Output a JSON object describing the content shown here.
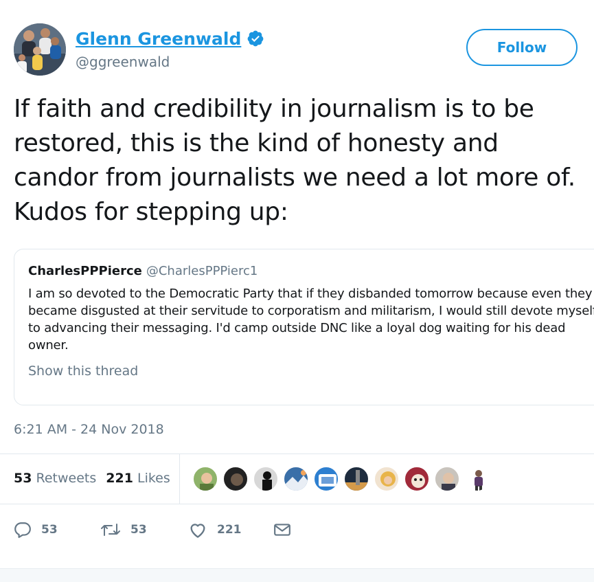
{
  "author": {
    "display_name": "Glenn Greenwald",
    "handle": "@ggreenwald",
    "verified": true
  },
  "follow_button": {
    "label": "Follow"
  },
  "tweet": {
    "text": "If faith and credibility in journalism is to be restored, this is the kind of honesty and candor from journalists we need a lot more of. Kudos for stepping up:"
  },
  "quoted_tweet": {
    "name": "CharlesPPPierce",
    "handle": "@CharlesPPPierc1",
    "text": "I am so devoted to the Democratic Party that if they disbanded tomorrow because even they became disgusted at their servitude to corporatism and militarism, I would still devote myself to advancing their messaging. I'd camp outside DNC like a loyal dog waiting for his dead owner.",
    "show_thread": "Show this thread"
  },
  "timestamp": "6:21 AM - 24 Nov 2018",
  "stats": {
    "retweets_count": "53",
    "retweets_label": "Retweets",
    "likes_count": "221",
    "likes_label": "Likes"
  },
  "actions": {
    "replies": "53",
    "retweets": "53",
    "likes": "221"
  },
  "colors": {
    "accent": "#1b95e0",
    "secondary_text": "#657786",
    "border": "#e1e8ed"
  },
  "icons": [
    "verified-badge-icon",
    "reply-icon",
    "retweet-icon",
    "heart-icon",
    "direct-message-icon"
  ]
}
